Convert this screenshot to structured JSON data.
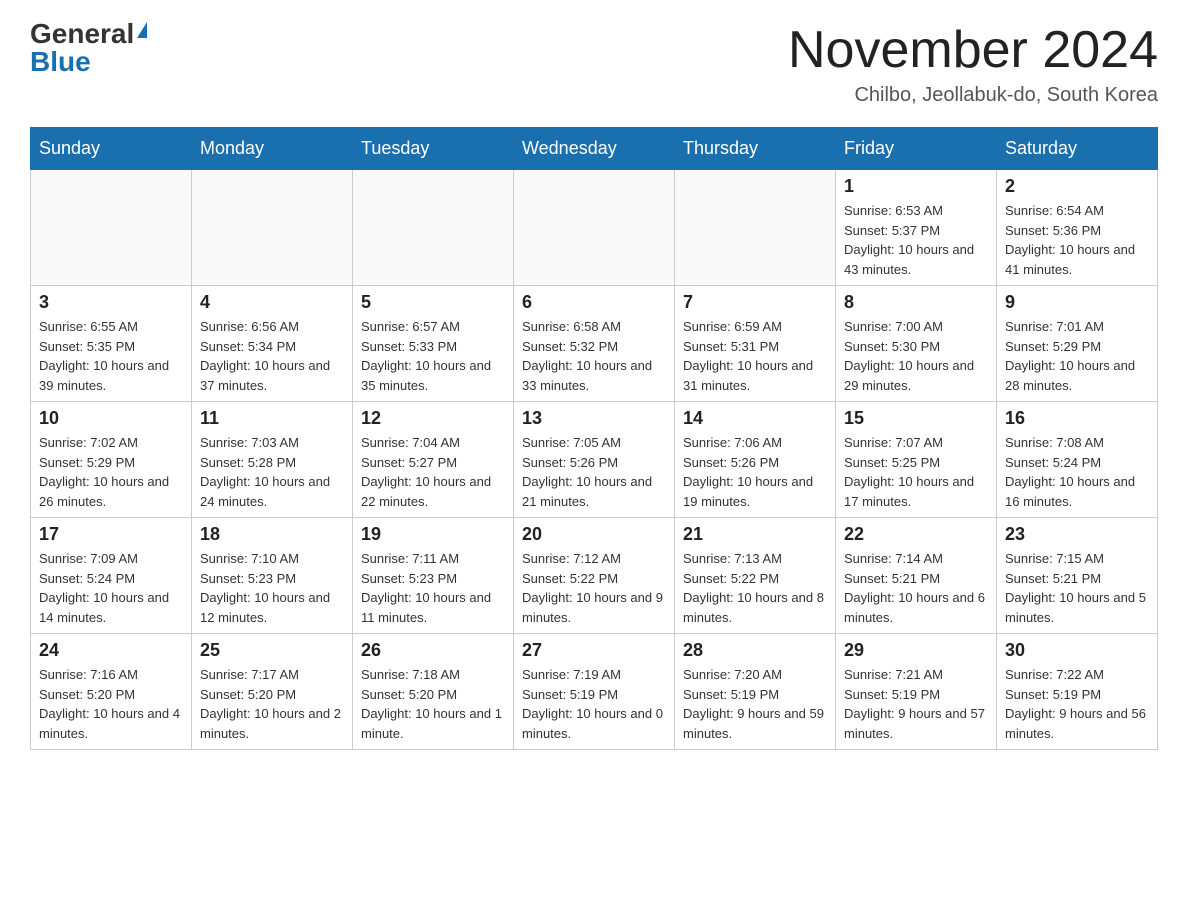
{
  "header": {
    "logo_general": "General",
    "logo_blue": "Blue",
    "month_title": "November 2024",
    "location": "Chilbo, Jeollabuk-do, South Korea"
  },
  "weekdays": [
    "Sunday",
    "Monday",
    "Tuesday",
    "Wednesday",
    "Thursday",
    "Friday",
    "Saturday"
  ],
  "weeks": [
    [
      {
        "day": "",
        "info": ""
      },
      {
        "day": "",
        "info": ""
      },
      {
        "day": "",
        "info": ""
      },
      {
        "day": "",
        "info": ""
      },
      {
        "day": "",
        "info": ""
      },
      {
        "day": "1",
        "info": "Sunrise: 6:53 AM\nSunset: 5:37 PM\nDaylight: 10 hours and 43 minutes."
      },
      {
        "day": "2",
        "info": "Sunrise: 6:54 AM\nSunset: 5:36 PM\nDaylight: 10 hours and 41 minutes."
      }
    ],
    [
      {
        "day": "3",
        "info": "Sunrise: 6:55 AM\nSunset: 5:35 PM\nDaylight: 10 hours and 39 minutes."
      },
      {
        "day": "4",
        "info": "Sunrise: 6:56 AM\nSunset: 5:34 PM\nDaylight: 10 hours and 37 minutes."
      },
      {
        "day": "5",
        "info": "Sunrise: 6:57 AM\nSunset: 5:33 PM\nDaylight: 10 hours and 35 minutes."
      },
      {
        "day": "6",
        "info": "Sunrise: 6:58 AM\nSunset: 5:32 PM\nDaylight: 10 hours and 33 minutes."
      },
      {
        "day": "7",
        "info": "Sunrise: 6:59 AM\nSunset: 5:31 PM\nDaylight: 10 hours and 31 minutes."
      },
      {
        "day": "8",
        "info": "Sunrise: 7:00 AM\nSunset: 5:30 PM\nDaylight: 10 hours and 29 minutes."
      },
      {
        "day": "9",
        "info": "Sunrise: 7:01 AM\nSunset: 5:29 PM\nDaylight: 10 hours and 28 minutes."
      }
    ],
    [
      {
        "day": "10",
        "info": "Sunrise: 7:02 AM\nSunset: 5:29 PM\nDaylight: 10 hours and 26 minutes."
      },
      {
        "day": "11",
        "info": "Sunrise: 7:03 AM\nSunset: 5:28 PM\nDaylight: 10 hours and 24 minutes."
      },
      {
        "day": "12",
        "info": "Sunrise: 7:04 AM\nSunset: 5:27 PM\nDaylight: 10 hours and 22 minutes."
      },
      {
        "day": "13",
        "info": "Sunrise: 7:05 AM\nSunset: 5:26 PM\nDaylight: 10 hours and 21 minutes."
      },
      {
        "day": "14",
        "info": "Sunrise: 7:06 AM\nSunset: 5:26 PM\nDaylight: 10 hours and 19 minutes."
      },
      {
        "day": "15",
        "info": "Sunrise: 7:07 AM\nSunset: 5:25 PM\nDaylight: 10 hours and 17 minutes."
      },
      {
        "day": "16",
        "info": "Sunrise: 7:08 AM\nSunset: 5:24 PM\nDaylight: 10 hours and 16 minutes."
      }
    ],
    [
      {
        "day": "17",
        "info": "Sunrise: 7:09 AM\nSunset: 5:24 PM\nDaylight: 10 hours and 14 minutes."
      },
      {
        "day": "18",
        "info": "Sunrise: 7:10 AM\nSunset: 5:23 PM\nDaylight: 10 hours and 12 minutes."
      },
      {
        "day": "19",
        "info": "Sunrise: 7:11 AM\nSunset: 5:23 PM\nDaylight: 10 hours and 11 minutes."
      },
      {
        "day": "20",
        "info": "Sunrise: 7:12 AM\nSunset: 5:22 PM\nDaylight: 10 hours and 9 minutes."
      },
      {
        "day": "21",
        "info": "Sunrise: 7:13 AM\nSunset: 5:22 PM\nDaylight: 10 hours and 8 minutes."
      },
      {
        "day": "22",
        "info": "Sunrise: 7:14 AM\nSunset: 5:21 PM\nDaylight: 10 hours and 6 minutes."
      },
      {
        "day": "23",
        "info": "Sunrise: 7:15 AM\nSunset: 5:21 PM\nDaylight: 10 hours and 5 minutes."
      }
    ],
    [
      {
        "day": "24",
        "info": "Sunrise: 7:16 AM\nSunset: 5:20 PM\nDaylight: 10 hours and 4 minutes."
      },
      {
        "day": "25",
        "info": "Sunrise: 7:17 AM\nSunset: 5:20 PM\nDaylight: 10 hours and 2 minutes."
      },
      {
        "day": "26",
        "info": "Sunrise: 7:18 AM\nSunset: 5:20 PM\nDaylight: 10 hours and 1 minute."
      },
      {
        "day": "27",
        "info": "Sunrise: 7:19 AM\nSunset: 5:19 PM\nDaylight: 10 hours and 0 minutes."
      },
      {
        "day": "28",
        "info": "Sunrise: 7:20 AM\nSunset: 5:19 PM\nDaylight: 9 hours and 59 minutes."
      },
      {
        "day": "29",
        "info": "Sunrise: 7:21 AM\nSunset: 5:19 PM\nDaylight: 9 hours and 57 minutes."
      },
      {
        "day": "30",
        "info": "Sunrise: 7:22 AM\nSunset: 5:19 PM\nDaylight: 9 hours and 56 minutes."
      }
    ]
  ]
}
